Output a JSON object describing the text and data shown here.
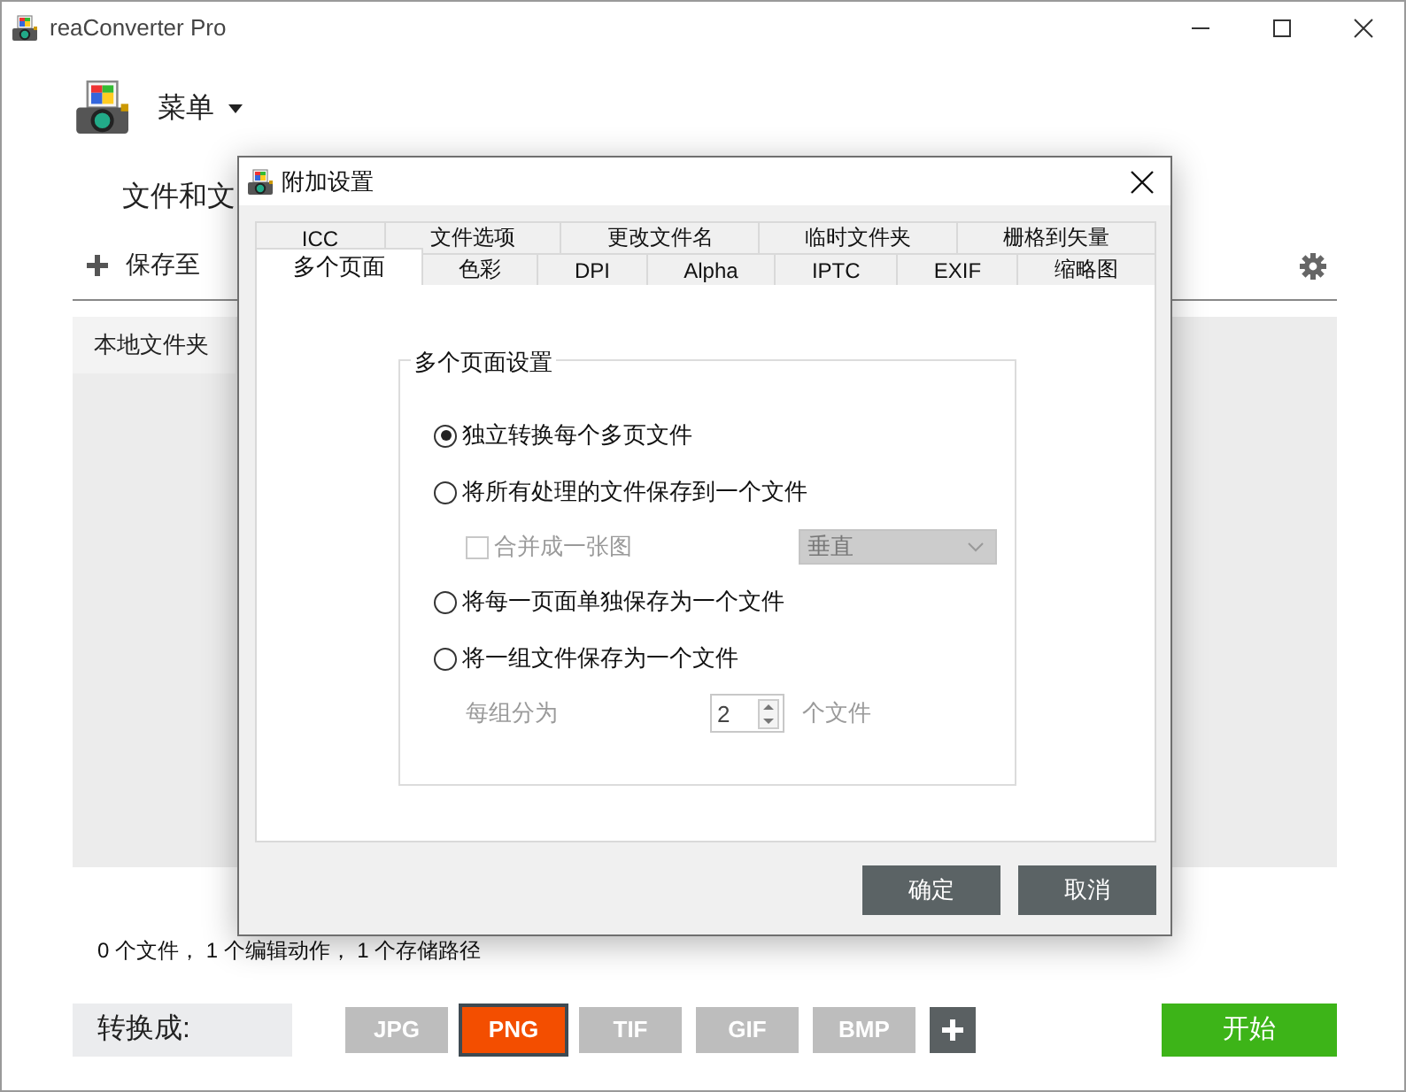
{
  "window": {
    "title": "reaConverter Pro"
  },
  "menu": {
    "label": "菜单"
  },
  "section_heading": "文件和文",
  "save_to": {
    "label": "保存至"
  },
  "panel": {
    "tab_label": "本地文件夹"
  },
  "status_bar": "0 个文件， 1 个编辑动作， 1 个存储路径",
  "convert": {
    "label": "转换成:",
    "formats": [
      {
        "label": "JPG",
        "selected": false
      },
      {
        "label": "PNG",
        "selected": true
      },
      {
        "label": "TIF",
        "selected": false
      },
      {
        "label": "GIF",
        "selected": false
      },
      {
        "label": "BMP",
        "selected": false
      }
    ],
    "start": "开始"
  },
  "dialog": {
    "title": "附加设置",
    "tab_rows": [
      [
        {
          "label": "ICC",
          "selected": false
        },
        {
          "label": "文件选项",
          "selected": false
        },
        {
          "label": "更改文件名",
          "selected": false
        },
        {
          "label": "临时文件夹",
          "selected": false
        },
        {
          "label": "栅格到矢量",
          "selected": false
        }
      ],
      [
        {
          "label": "多个页面",
          "selected": true
        },
        {
          "label": "色彩",
          "selected": false
        },
        {
          "label": "DPI",
          "selected": false
        },
        {
          "label": "Alpha",
          "selected": false
        },
        {
          "label": "IPTC",
          "selected": false
        },
        {
          "label": "EXIF",
          "selected": false
        },
        {
          "label": "缩略图",
          "selected": false
        }
      ]
    ],
    "group": {
      "title": "多个页面设置",
      "options": [
        {
          "kind": "radio",
          "label": "独立转换每个多页文件",
          "selected": true
        },
        {
          "kind": "radio",
          "label": "将所有处理的文件保存到一个文件",
          "selected": false
        },
        {
          "kind": "checkbox",
          "label": "合并成一张图",
          "checked": false,
          "disabled": true,
          "dropdown": "垂直"
        },
        {
          "kind": "radio",
          "label": "将每一页面单独保存为一个文件",
          "selected": false
        },
        {
          "kind": "radio",
          "label": "将一组文件保存为一个文件",
          "selected": false
        },
        {
          "kind": "spin",
          "label": "每组分为",
          "value": "2",
          "unit": "个文件",
          "disabled": true
        }
      ]
    },
    "buttons": [
      "确定",
      "取消"
    ]
  }
}
